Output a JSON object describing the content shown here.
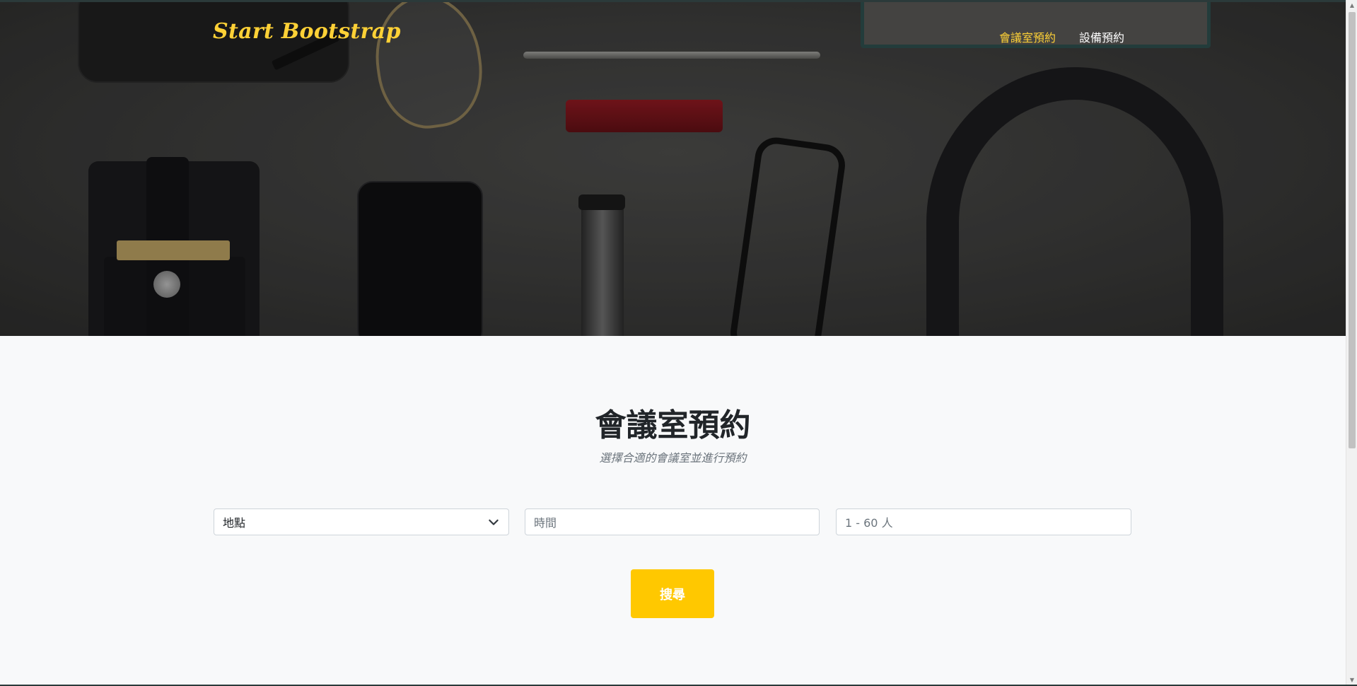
{
  "navbar": {
    "brand": "Start Bootstrap",
    "links": [
      {
        "label": "會議室預約",
        "active": true
      },
      {
        "label": "設備預約",
        "active": false
      }
    ]
  },
  "main": {
    "title": "會議室預約",
    "subtitle": "選擇合適的會議室並進行預約",
    "location_select": {
      "selected": "地點"
    },
    "time_input": {
      "placeholder": "時間"
    },
    "people_input": {
      "placeholder": "1 - 60 人"
    },
    "search_label": "搜尋"
  },
  "icons": {
    "chevron": "chevron-down-icon",
    "scroll_up": "arrow-up-icon",
    "scroll_down": "arrow-down-icon"
  },
  "colors": {
    "accent": "#fed136",
    "button": "#ffc800",
    "page_bg": "#f8f9fa",
    "text": "#212529",
    "muted": "#6c757d"
  }
}
